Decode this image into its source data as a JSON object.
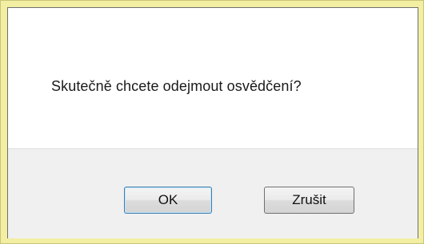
{
  "dialog": {
    "message": "Skutečně chcete odejmout osvědčení?",
    "ok_label": "OK",
    "cancel_label": "Zrušit"
  }
}
